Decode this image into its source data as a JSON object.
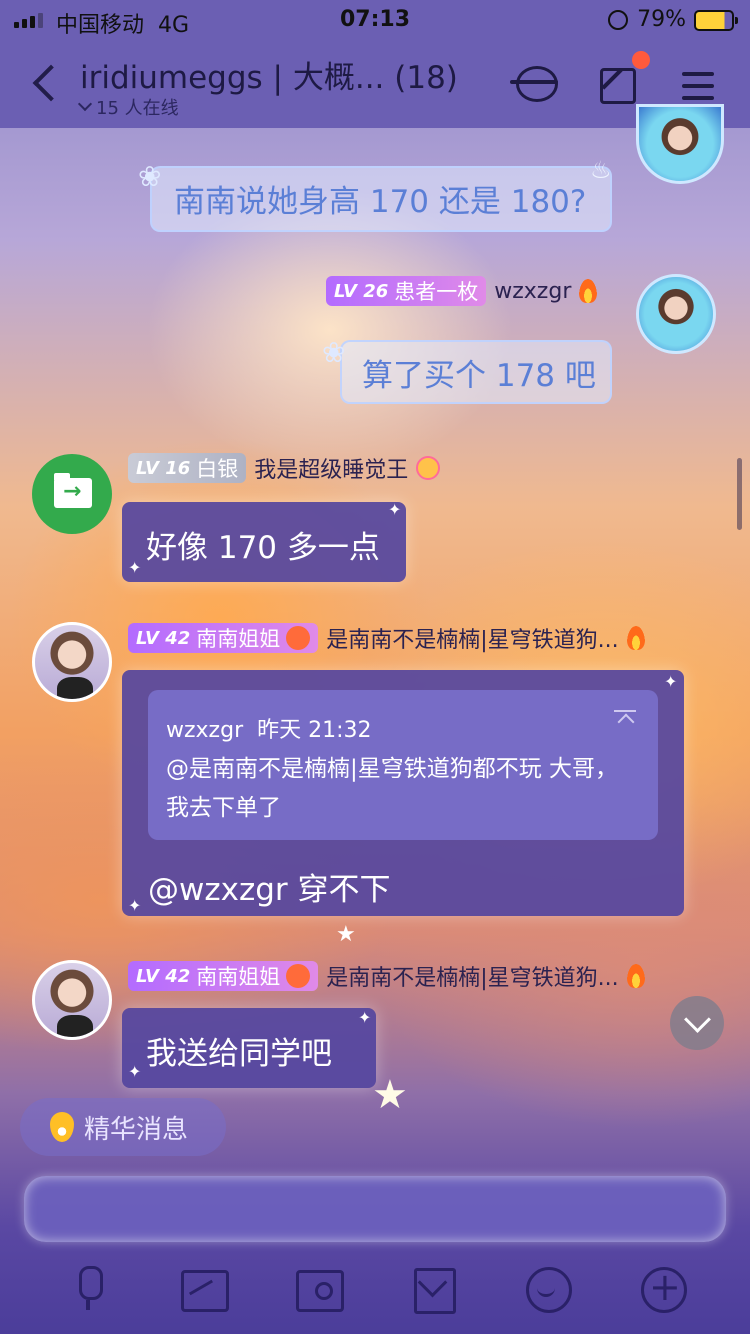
{
  "status_bar": {
    "carrier": "中国移动",
    "network": "4G",
    "time": "07:13",
    "battery": "79%"
  },
  "header": {
    "title": "iridiumeggs | 大概... (18)",
    "online": "15 人在线"
  },
  "messages": [
    {
      "text": "南南说她身高 170 还是 180?"
    },
    {
      "level": "LV 26",
      "title": "患者一枚",
      "nickname": "wzxzgr",
      "text": "算了买个 178 吧"
    },
    {
      "level": "LV 16",
      "title": "白银",
      "nickname": "我是超级睡觉王",
      "text": "好像 170 多一点"
    },
    {
      "level": "LV 42",
      "title": "南南姐姐",
      "nickname": "是南南不是楠楠|星穹铁道狗...",
      "quote": {
        "author": "wzxzgr",
        "time": "昨天 21:32",
        "text": "@是南南不是楠楠|星穹铁道狗都不玩 大哥，我去下单了"
      },
      "text": "@wzxzgr 穿不下"
    },
    {
      "level": "LV 42",
      "title": "南南姐姐",
      "nickname": "是南南不是楠楠|星穹铁道狗...",
      "text": "我送给同学吧"
    }
  ],
  "essence": {
    "label": "精华消息"
  },
  "input": {
    "placeholder": ""
  }
}
